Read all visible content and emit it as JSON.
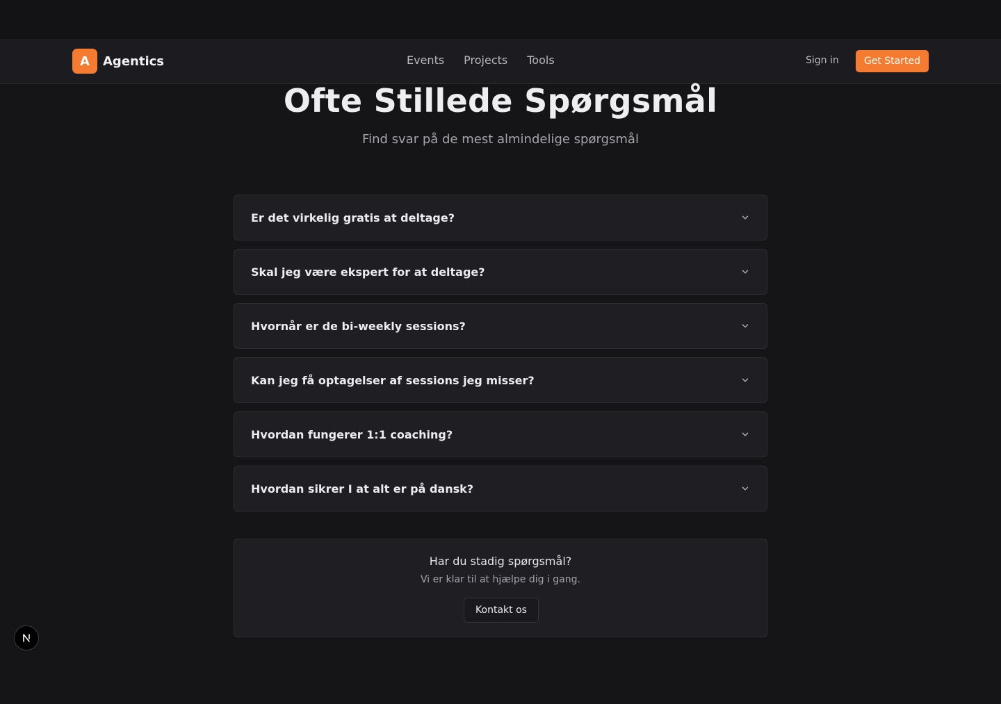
{
  "header": {
    "brand_letter": "A",
    "brand_name": "Agentics",
    "nav": [
      {
        "label": "Events"
      },
      {
        "label": "Projects"
      },
      {
        "label": "Tools"
      }
    ],
    "sign_in": "Sign in",
    "get_started": "Get Started",
    "accent_color": "#f47b2f"
  },
  "main": {
    "title": "Ofte Stillede Spørgsmål",
    "subtitle": "Find svar på de mest almindelige spørgsmål",
    "faq": [
      {
        "question": "Er det virkelig gratis at deltage?"
      },
      {
        "question": "Skal jeg være ekspert for at deltage?"
      },
      {
        "question": "Hvornår er de bi-weekly sessions?"
      },
      {
        "question": "Kan jeg få optagelser af sessions jeg misser?"
      },
      {
        "question": "Hvordan fungerer 1:1 coaching?"
      },
      {
        "question": "Hvordan sikrer I at alt er på dansk?"
      }
    ],
    "contact": {
      "title": "Har du stadig spørgsmål?",
      "text": "Vi er klar til at hjælpe dig i gang.",
      "button": "Kontakt os"
    }
  },
  "icons": {
    "faq_toggle": "chevron-down-icon",
    "dev_badge": "nextjs-logo-icon"
  }
}
